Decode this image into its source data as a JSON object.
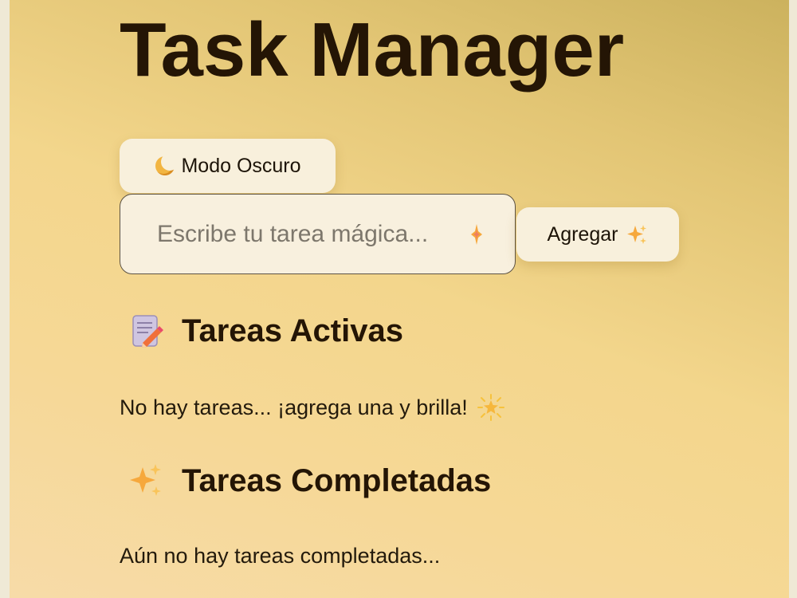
{
  "app": {
    "title": "Task Manager"
  },
  "mode_button": {
    "label": "Modo Oscuro",
    "icon": "crescent-moon-icon"
  },
  "task_form": {
    "input_value": "",
    "input_placeholder": "Escribe tu tarea mágica... ",
    "add_label": "Agregar",
    "add_icon": "sparkles-icon"
  },
  "active_section": {
    "heading": "Tareas Activas",
    "icon": "memo-icon",
    "empty_message": "No hay tareas... ¡agrega una y brilla!",
    "empty_icon": "glowing-star-icon"
  },
  "completed_section": {
    "heading": "Tareas Completadas",
    "icon": "sparkles-icon",
    "empty_message": "Aún no hay tareas completadas..."
  },
  "colors": {
    "background_top": "#ccb25e",
    "background_bottom": "#f7dba8",
    "button_background": "#f8f0dc",
    "text_dark": "#241505",
    "sparkle_accent": "#f6a83c"
  }
}
